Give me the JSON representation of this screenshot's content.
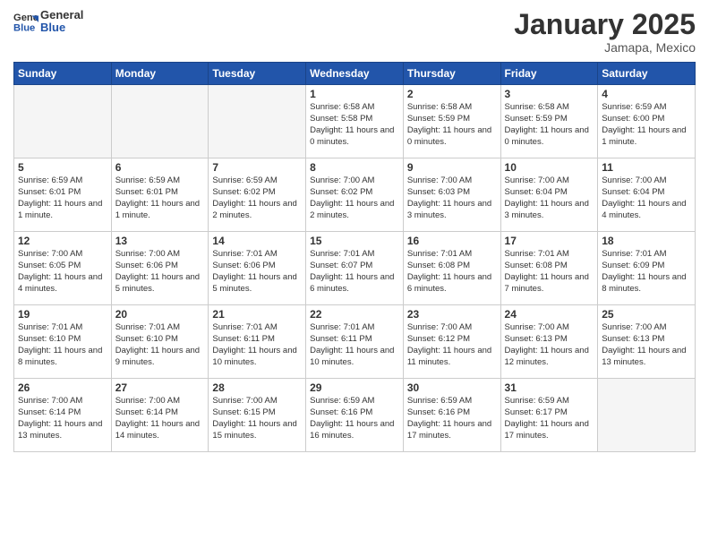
{
  "logo": {
    "general": "General",
    "blue": "Blue"
  },
  "title": "January 2025",
  "location": "Jamapa, Mexico",
  "days_header": [
    "Sunday",
    "Monday",
    "Tuesday",
    "Wednesday",
    "Thursday",
    "Friday",
    "Saturday"
  ],
  "weeks": [
    [
      {
        "day": "",
        "info": ""
      },
      {
        "day": "",
        "info": ""
      },
      {
        "day": "",
        "info": ""
      },
      {
        "day": "1",
        "info": "Sunrise: 6:58 AM\nSunset: 5:58 PM\nDaylight: 11 hours\nand 0 minutes."
      },
      {
        "day": "2",
        "info": "Sunrise: 6:58 AM\nSunset: 5:59 PM\nDaylight: 11 hours\nand 0 minutes."
      },
      {
        "day": "3",
        "info": "Sunrise: 6:58 AM\nSunset: 5:59 PM\nDaylight: 11 hours\nand 0 minutes."
      },
      {
        "day": "4",
        "info": "Sunrise: 6:59 AM\nSunset: 6:00 PM\nDaylight: 11 hours\nand 1 minute."
      }
    ],
    [
      {
        "day": "5",
        "info": "Sunrise: 6:59 AM\nSunset: 6:01 PM\nDaylight: 11 hours\nand 1 minute."
      },
      {
        "day": "6",
        "info": "Sunrise: 6:59 AM\nSunset: 6:01 PM\nDaylight: 11 hours\nand 1 minute."
      },
      {
        "day": "7",
        "info": "Sunrise: 6:59 AM\nSunset: 6:02 PM\nDaylight: 11 hours\nand 2 minutes."
      },
      {
        "day": "8",
        "info": "Sunrise: 7:00 AM\nSunset: 6:02 PM\nDaylight: 11 hours\nand 2 minutes."
      },
      {
        "day": "9",
        "info": "Sunrise: 7:00 AM\nSunset: 6:03 PM\nDaylight: 11 hours\nand 3 minutes."
      },
      {
        "day": "10",
        "info": "Sunrise: 7:00 AM\nSunset: 6:04 PM\nDaylight: 11 hours\nand 3 minutes."
      },
      {
        "day": "11",
        "info": "Sunrise: 7:00 AM\nSunset: 6:04 PM\nDaylight: 11 hours\nand 4 minutes."
      }
    ],
    [
      {
        "day": "12",
        "info": "Sunrise: 7:00 AM\nSunset: 6:05 PM\nDaylight: 11 hours\nand 4 minutes."
      },
      {
        "day": "13",
        "info": "Sunrise: 7:00 AM\nSunset: 6:06 PM\nDaylight: 11 hours\nand 5 minutes."
      },
      {
        "day": "14",
        "info": "Sunrise: 7:01 AM\nSunset: 6:06 PM\nDaylight: 11 hours\nand 5 minutes."
      },
      {
        "day": "15",
        "info": "Sunrise: 7:01 AM\nSunset: 6:07 PM\nDaylight: 11 hours\nand 6 minutes."
      },
      {
        "day": "16",
        "info": "Sunrise: 7:01 AM\nSunset: 6:08 PM\nDaylight: 11 hours\nand 6 minutes."
      },
      {
        "day": "17",
        "info": "Sunrise: 7:01 AM\nSunset: 6:08 PM\nDaylight: 11 hours\nand 7 minutes."
      },
      {
        "day": "18",
        "info": "Sunrise: 7:01 AM\nSunset: 6:09 PM\nDaylight: 11 hours\nand 8 minutes."
      }
    ],
    [
      {
        "day": "19",
        "info": "Sunrise: 7:01 AM\nSunset: 6:10 PM\nDaylight: 11 hours\nand 8 minutes."
      },
      {
        "day": "20",
        "info": "Sunrise: 7:01 AM\nSunset: 6:10 PM\nDaylight: 11 hours\nand 9 minutes."
      },
      {
        "day": "21",
        "info": "Sunrise: 7:01 AM\nSunset: 6:11 PM\nDaylight: 11 hours\nand 10 minutes."
      },
      {
        "day": "22",
        "info": "Sunrise: 7:01 AM\nSunset: 6:11 PM\nDaylight: 11 hours\nand 10 minutes."
      },
      {
        "day": "23",
        "info": "Sunrise: 7:00 AM\nSunset: 6:12 PM\nDaylight: 11 hours\nand 11 minutes."
      },
      {
        "day": "24",
        "info": "Sunrise: 7:00 AM\nSunset: 6:13 PM\nDaylight: 11 hours\nand 12 minutes."
      },
      {
        "day": "25",
        "info": "Sunrise: 7:00 AM\nSunset: 6:13 PM\nDaylight: 11 hours\nand 13 minutes."
      }
    ],
    [
      {
        "day": "26",
        "info": "Sunrise: 7:00 AM\nSunset: 6:14 PM\nDaylight: 11 hours\nand 13 minutes."
      },
      {
        "day": "27",
        "info": "Sunrise: 7:00 AM\nSunset: 6:14 PM\nDaylight: 11 hours\nand 14 minutes."
      },
      {
        "day": "28",
        "info": "Sunrise: 7:00 AM\nSunset: 6:15 PM\nDaylight: 11 hours\nand 15 minutes."
      },
      {
        "day": "29",
        "info": "Sunrise: 6:59 AM\nSunset: 6:16 PM\nDaylight: 11 hours\nand 16 minutes."
      },
      {
        "day": "30",
        "info": "Sunrise: 6:59 AM\nSunset: 6:16 PM\nDaylight: 11 hours\nand 17 minutes."
      },
      {
        "day": "31",
        "info": "Sunrise: 6:59 AM\nSunset: 6:17 PM\nDaylight: 11 hours\nand 17 minutes."
      },
      {
        "day": "",
        "info": ""
      }
    ]
  ]
}
